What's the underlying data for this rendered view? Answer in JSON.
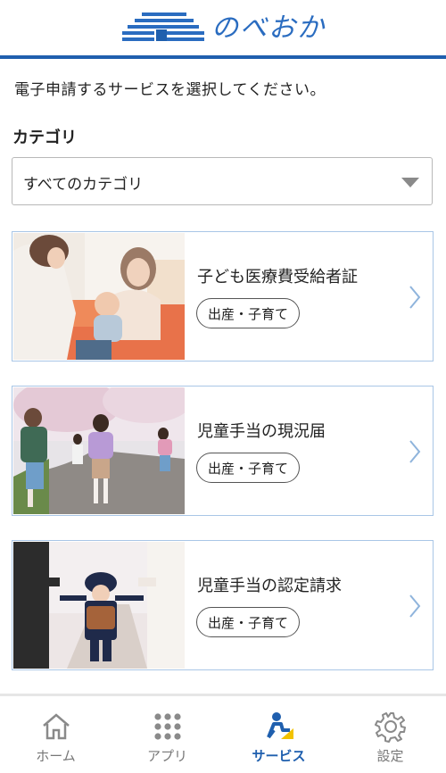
{
  "header": {
    "logo_text": "のべおか"
  },
  "intro": {
    "text": "電子申請するサービスを選択してください。"
  },
  "category": {
    "label": "カテゴリ",
    "selected": "すべてのカテゴリ"
  },
  "services": [
    {
      "title": "子ども医療費受給者証",
      "tag": "出産・子育て"
    },
    {
      "title": "児童手当の現況届",
      "tag": "出産・子育て"
    },
    {
      "title": "児童手当の認定請求",
      "tag": "出産・子育て"
    }
  ],
  "nav": [
    {
      "label": "ホーム",
      "icon": "home-icon"
    },
    {
      "label": "アプリ",
      "icon": "apps-grid-icon"
    },
    {
      "label": "サービス",
      "icon": "service-person-icon",
      "active": true
    },
    {
      "label": "設定",
      "icon": "gear-icon"
    }
  ],
  "colors": {
    "brand": "#1f5fae",
    "card_border": "#a9c6e6",
    "active_nav": "#1f5fae",
    "active_icon_yellow": "#f2c200"
  }
}
